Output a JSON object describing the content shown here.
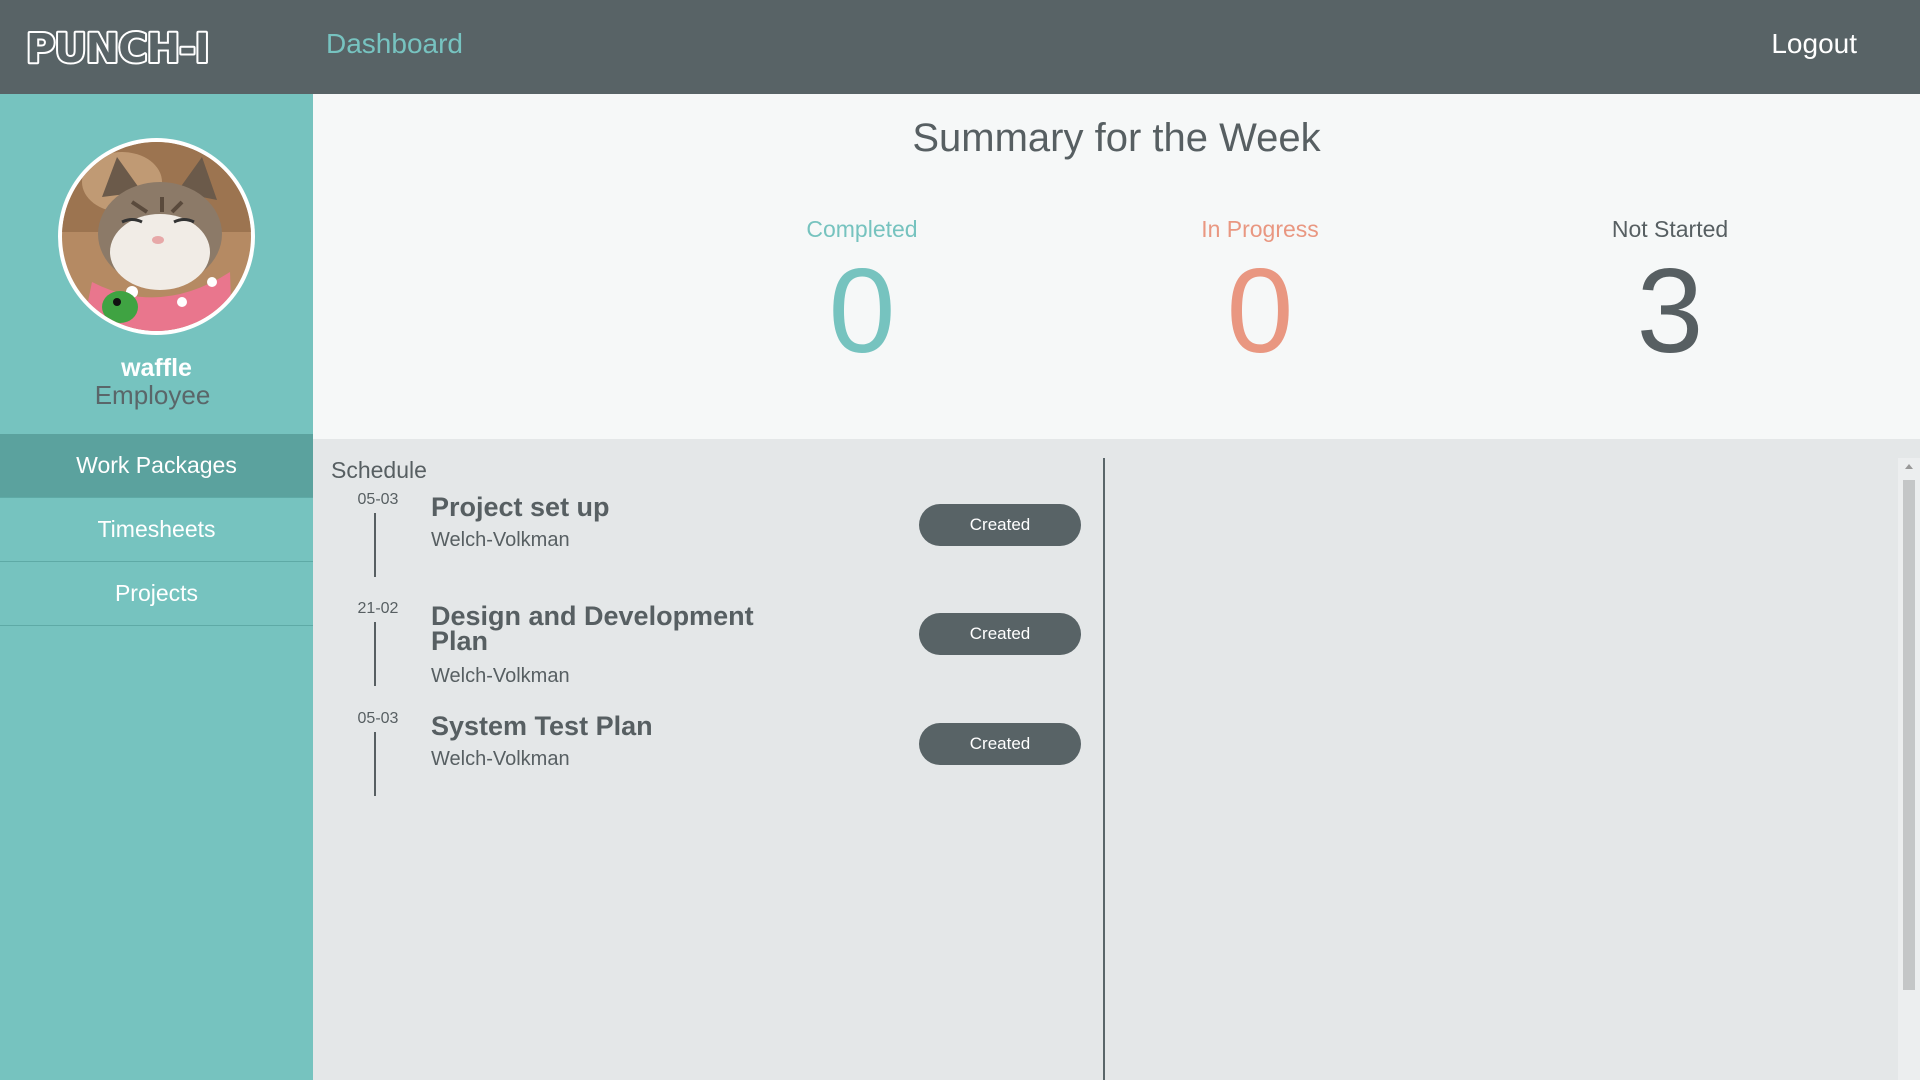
{
  "header": {
    "logo_text": "PUNCH-IN",
    "nav_dashboard": "Dashboard",
    "logout": "Logout"
  },
  "user": {
    "name": "waffle",
    "role": "Employee"
  },
  "sidebar": {
    "items": [
      {
        "label": "Work Packages",
        "active": true
      },
      {
        "label": "Timesheets",
        "active": false
      },
      {
        "label": "Projects",
        "active": false
      }
    ]
  },
  "summary": {
    "title": "Summary for the Week",
    "stats": [
      {
        "label": "Completed",
        "value": "0",
        "color": "#76c3bf"
      },
      {
        "label": "In Progress",
        "value": "0",
        "color": "#e99781"
      },
      {
        "label": "Not Started",
        "value": "3",
        "color": "#575f62"
      }
    ]
  },
  "schedule": {
    "title": "Schedule",
    "items": [
      {
        "date": "05-03",
        "title": "Project set up",
        "company": "Welch-Volkman",
        "status": "Created"
      },
      {
        "date": "21-02",
        "title": "Design and Development Plan",
        "company": "Welch-Volkman",
        "status": "Created"
      },
      {
        "date": "05-03",
        "title": "System Test Plan",
        "company": "Welch-Volkman",
        "status": "Created"
      }
    ]
  },
  "colors": {
    "header_bg": "#586366",
    "sidebar_bg": "#76c3bf",
    "accent_teal": "#76c3bf",
    "accent_salmon": "#e99781"
  }
}
